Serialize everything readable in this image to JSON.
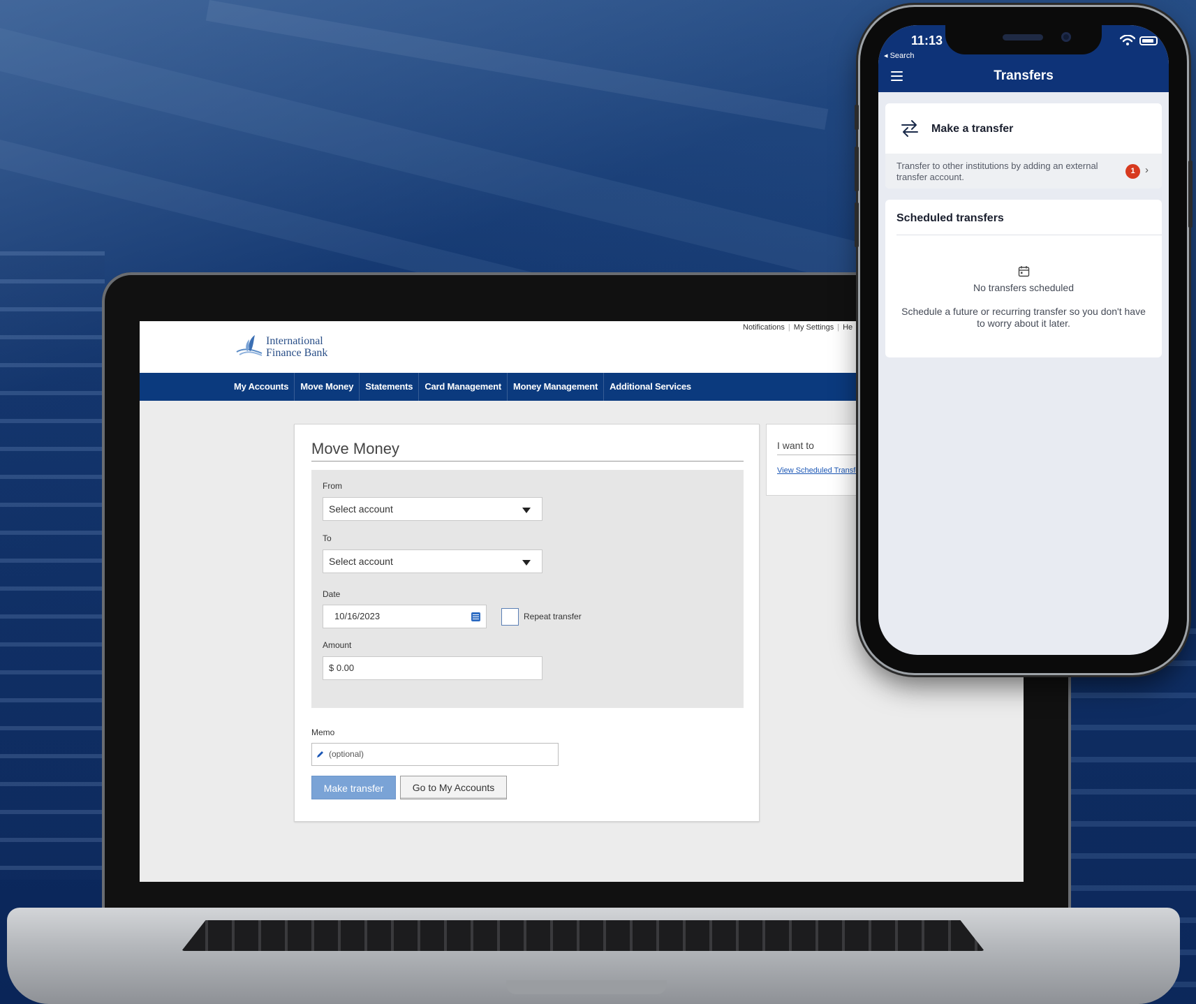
{
  "website": {
    "brand": {
      "line1": "International",
      "line2": "Finance Bank"
    },
    "utility_links": [
      "Notifications",
      "My Settings",
      "He"
    ],
    "nav": [
      "My Accounts",
      "Move Money",
      "Statements",
      "Card Management",
      "Money Management",
      "Additional Services"
    ],
    "move_money": {
      "title": "Move Money",
      "from_label": "From",
      "from_value": "Select account",
      "to_label": "To",
      "to_value": "Select account",
      "date_label": "Date",
      "date_value": "10/16/2023",
      "repeat_label": "Repeat transfer",
      "amount_label": "Amount",
      "amount_value": "$  0.00",
      "memo_label": "Memo",
      "memo_placeholder": "(optional)",
      "make_transfer_button": "Make transfer",
      "go_accounts_button": "Go to My Accounts"
    },
    "side_panel": {
      "title": "I want to",
      "link": "View Scheduled Transfe"
    }
  },
  "phone": {
    "status": {
      "time": "11:13",
      "back_label": "◂ Search"
    },
    "app_title": "Transfers",
    "make_transfer": {
      "title": "Make a transfer",
      "description": "Transfer to other institutions by adding an external transfer account.",
      "badge_count": "1",
      "chevron": "›"
    },
    "scheduled": {
      "title": "Scheduled transfers",
      "empty_title": "No transfers scheduled",
      "empty_description": "Schedule a future or recurring transfer so you don't have to worry about it later."
    }
  },
  "colors": {
    "nav_blue": "#0b3a7e",
    "phone_header": "#0e3378",
    "primary_button": "#7aa3d6",
    "badge_red": "#d73a1f",
    "background_navy": "#0d2a5a"
  },
  "icons": [
    "bank-logo-icon",
    "calendar-icon",
    "pencil-icon",
    "transfer-arrows-icon",
    "wifi-icon",
    "battery-icon",
    "hamburger-menu-icon",
    "dropdown-caret-icon"
  ]
}
